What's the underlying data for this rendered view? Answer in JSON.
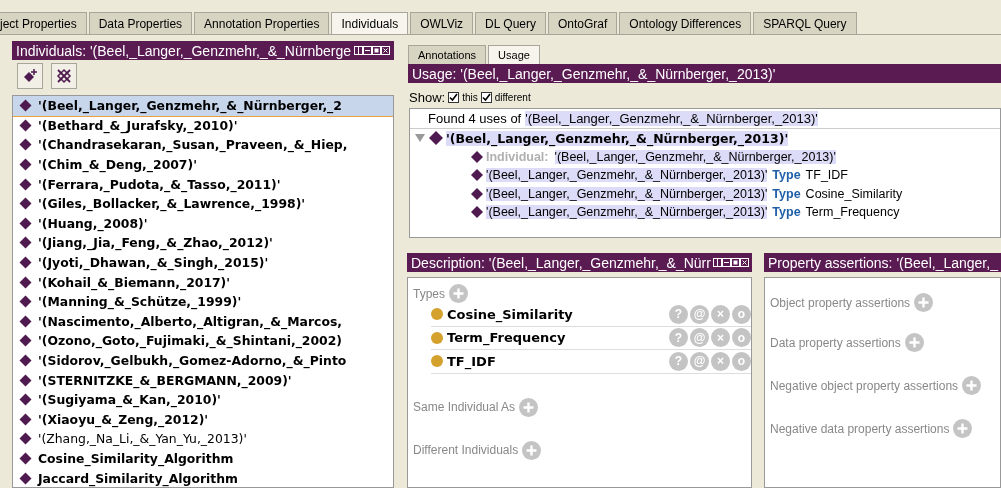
{
  "tabs": [
    {
      "label": "ject Properties",
      "selected": false
    },
    {
      "label": "Data Properties",
      "selected": false
    },
    {
      "label": "Annotation Properties",
      "selected": false
    },
    {
      "label": "Individuals",
      "selected": true
    },
    {
      "label": "OWLViz",
      "selected": false
    },
    {
      "label": "DL Query",
      "selected": false
    },
    {
      "label": "OntoGraf",
      "selected": false
    },
    {
      "label": "Ontology Differences",
      "selected": false
    },
    {
      "label": "SPARQL Query",
      "selected": false
    }
  ],
  "individuals_panel": {
    "title": "Individuals: '(Beel,_Langer,_Genzmehr,_&_Nürnberge",
    "items": [
      {
        "label": "'(Beel,_Langer,_Genzmehr,_&_Nürnberger,_2",
        "bold": true,
        "selected": true
      },
      {
        "label": "'(Bethard_&_Jurafsky,_2010)'",
        "bold": true,
        "selected": false
      },
      {
        "label": "'(Chandrasekaran,_Susan,_Praveen,_&_Hiep,",
        "bold": true,
        "selected": false
      },
      {
        "label": "'(Chim_&_Deng,_2007)'",
        "bold": true,
        "selected": false
      },
      {
        "label": "'(Ferrara,_Pudota,_&_Tasso,_2011)'",
        "bold": true,
        "selected": false
      },
      {
        "label": "'(Giles,_Bollacker,_&_Lawrence,_1998)'",
        "bold": true,
        "selected": false
      },
      {
        "label": "'(Huang,_2008)'",
        "bold": true,
        "selected": false
      },
      {
        "label": "'(Jiang,_Jia,_Feng,_&_Zhao,_2012)'",
        "bold": true,
        "selected": false
      },
      {
        "label": "'(Jyoti,_Dhawan,_&_Singh,_2015)'",
        "bold": true,
        "selected": false
      },
      {
        "label": "'(Kohail_&_Biemann,_2017)'",
        "bold": true,
        "selected": false
      },
      {
        "label": "'(Manning_&_Schütze,_1999)'",
        "bold": true,
        "selected": false
      },
      {
        "label": "'(Nascimento,_Alberto,_Altigran,_&_Marcos,",
        "bold": true,
        "selected": false
      },
      {
        "label": "'(Ozono,_Goto,_Fujimaki,_&_Shintani,_2002)",
        "bold": true,
        "selected": false
      },
      {
        "label": "'(Sidorov,_Gelbukh,_Gomez-Adorno,_&_Pinto",
        "bold": true,
        "selected": false
      },
      {
        "label": "'(STERNITZKE_&_BERGMANN,_2009)'",
        "bold": true,
        "selected": false
      },
      {
        "label": "'(Sugiyama_&_Kan,_2010)'",
        "bold": true,
        "selected": false
      },
      {
        "label": "'(Xiaoyu_&_Zeng,_2012)'",
        "bold": true,
        "selected": false
      },
      {
        "label": "'(Zhang,_Na_Li,_&_Yan_Yu,_2013)'",
        "bold": false,
        "selected": false
      },
      {
        "label": "Cosine_Similarity_Algorithm",
        "bold": true,
        "selected": false
      },
      {
        "label": "Jaccard_Similarity_Algorithm",
        "bold": true,
        "selected": false
      }
    ]
  },
  "usage_tabs": [
    {
      "label": "Annotations",
      "selected": false
    },
    {
      "label": "Usage",
      "selected": true
    }
  ],
  "usage": {
    "title": "Usage: '(Beel,_Langer,_Genzmehr,_&_Nürnberger,_2013)'",
    "show_label": "Show:",
    "show_options": [
      {
        "label": "this",
        "checked": true
      },
      {
        "label": "different",
        "checked": true
      }
    ],
    "found_prefix": "Found 4 uses of",
    "found_entity": "'(Beel,_Langer,_Genzmehr,_&_Nürnberger,_2013)'",
    "root": {
      "label": "'(Beel,_Langer,_Genzmehr,_&_Nürnberger,_2013)'",
      "expanded": true,
      "children": [
        {
          "kind": "individual",
          "keyword": "Individual:",
          "entity": "'(Beel,_Langer,_Genzmehr,_&_Nürnberger,_2013)'"
        },
        {
          "kind": "type",
          "entity": "'(Beel,_Langer,_Genzmehr,_&_Nürnberger,_2013)'",
          "keyword": "Type",
          "class": "TF_IDF"
        },
        {
          "kind": "type",
          "entity": "'(Beel,_Langer,_Genzmehr,_&_Nürnberger,_2013)'",
          "keyword": "Type",
          "class": "Cosine_Similarity"
        },
        {
          "kind": "type",
          "entity": "'(Beel,_Langer,_Genzmehr,_&_Nürnberger,_2013)'",
          "keyword": "Type",
          "class": "Term_Frequency"
        }
      ]
    }
  },
  "description": {
    "title": "Description: '(Beel,_Langer,_Genzmehr,_&_Nürr",
    "sections": [
      {
        "label": "Types",
        "items": [
          {
            "name": "Cosine_Similarity",
            "actions": [
              "?",
              "@",
              "×",
              "o"
            ]
          },
          {
            "name": "Term_Frequency",
            "actions": [
              "?",
              "@",
              "×",
              "o"
            ]
          },
          {
            "name": "TF_IDF",
            "actions": [
              "?",
              "@",
              "×",
              "o"
            ]
          }
        ]
      },
      {
        "label": "Same Individual As"
      },
      {
        "label": "Different Individuals"
      }
    ]
  },
  "property_assertions": {
    "title": "Property assertions: '(Beel,_Langer,_",
    "sections": [
      {
        "label": "Object property assertions"
      },
      {
        "label": "Data property assertions"
      },
      {
        "label": "Negative object property assertions"
      },
      {
        "label": "Negative data property assertions"
      }
    ]
  }
}
